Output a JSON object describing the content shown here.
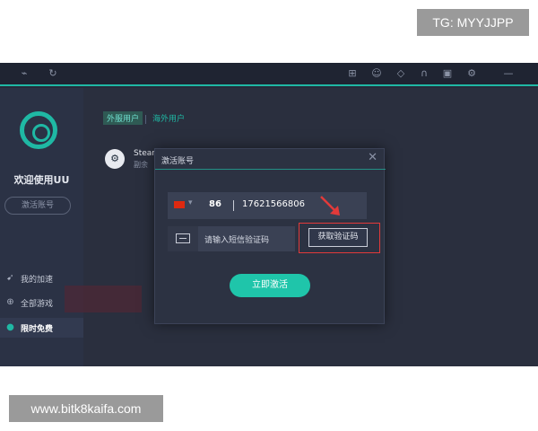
{
  "watermarks": {
    "top_right": "TG: MYYJJPP",
    "bottom_left": "www.bitk8kaifa.com"
  },
  "topbar": {
    "icons": [
      "cart-icon",
      "chat-icon",
      "tag-icon",
      "headset-icon",
      "gift-icon",
      "gear-icon",
      "minimize-icon"
    ]
  },
  "sidebar": {
    "welcome": "欢迎使用UU",
    "activate_label": "激活账号",
    "menu": [
      {
        "label": "我的加速",
        "icon": "rocket-icon"
      },
      {
        "label": "全部游戏",
        "icon": "gamepad-icon"
      },
      {
        "label": "限时免费",
        "icon": "gift-icon"
      }
    ],
    "accent": "#1fb8a4"
  },
  "main": {
    "tabs": [
      "外服用户",
      "海外用户"
    ],
    "game": {
      "name": "Stear",
      "sub": "副余"
    }
  },
  "dialog": {
    "title": "激活账号",
    "close": "✕",
    "country_code": "86",
    "phone": "17621566806",
    "code_placeholder": "请输入短信验证码",
    "get_code_label": "获取验证码",
    "activate_now_label": "立即激活"
  }
}
